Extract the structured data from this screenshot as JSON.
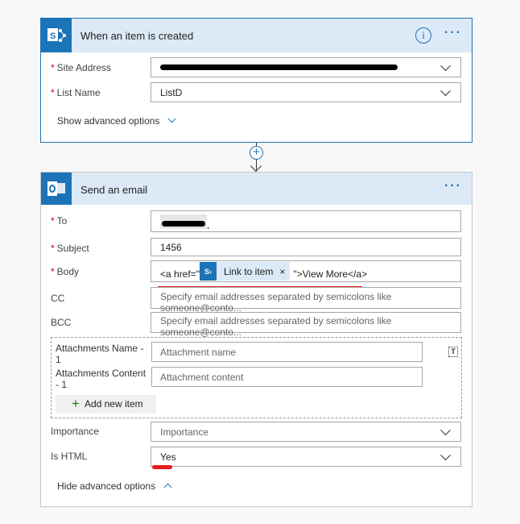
{
  "trigger": {
    "title": "When an item is created",
    "icon": "sharepoint-icon",
    "site_address_label": "Site Address",
    "site_address_value": "[redacted]",
    "list_name_label": "List Name",
    "list_name_value": "ListD",
    "show_advanced": "Show advanced options"
  },
  "action": {
    "title": "Send an email",
    "icon": "outlook-icon",
    "to_label": "To",
    "to_value": "[redacted],",
    "subject_label": "Subject",
    "subject_value": "1456",
    "body_label": "Body",
    "body_prefix": "<a href=\"",
    "body_token": "Link to item",
    "body_token_close": "×",
    "body_suffix": "\">View More</a>",
    "cc_label": "CC",
    "cc_placeholder": "Specify email addresses separated by semicolons like someone@conto...",
    "bcc_label": "BCC",
    "bcc_placeholder": "Specify email addresses separated by semicolons like someone@conto...",
    "att_name_label": "Attachments Name - 1",
    "att_name_placeholder": "Attachment name",
    "att_content_label": "Attachments Content - 1",
    "att_content_placeholder": "Attachment content",
    "add_new_item": "Add new item",
    "importance_label": "Importance",
    "importance_placeholder": "Importance",
    "is_html_label": "Is HTML",
    "is_html_value": "Yes",
    "hide_advanced": "Hide advanced options"
  },
  "colors": {
    "accent": "#1b73b8",
    "annotation": "#e41b1b"
  }
}
